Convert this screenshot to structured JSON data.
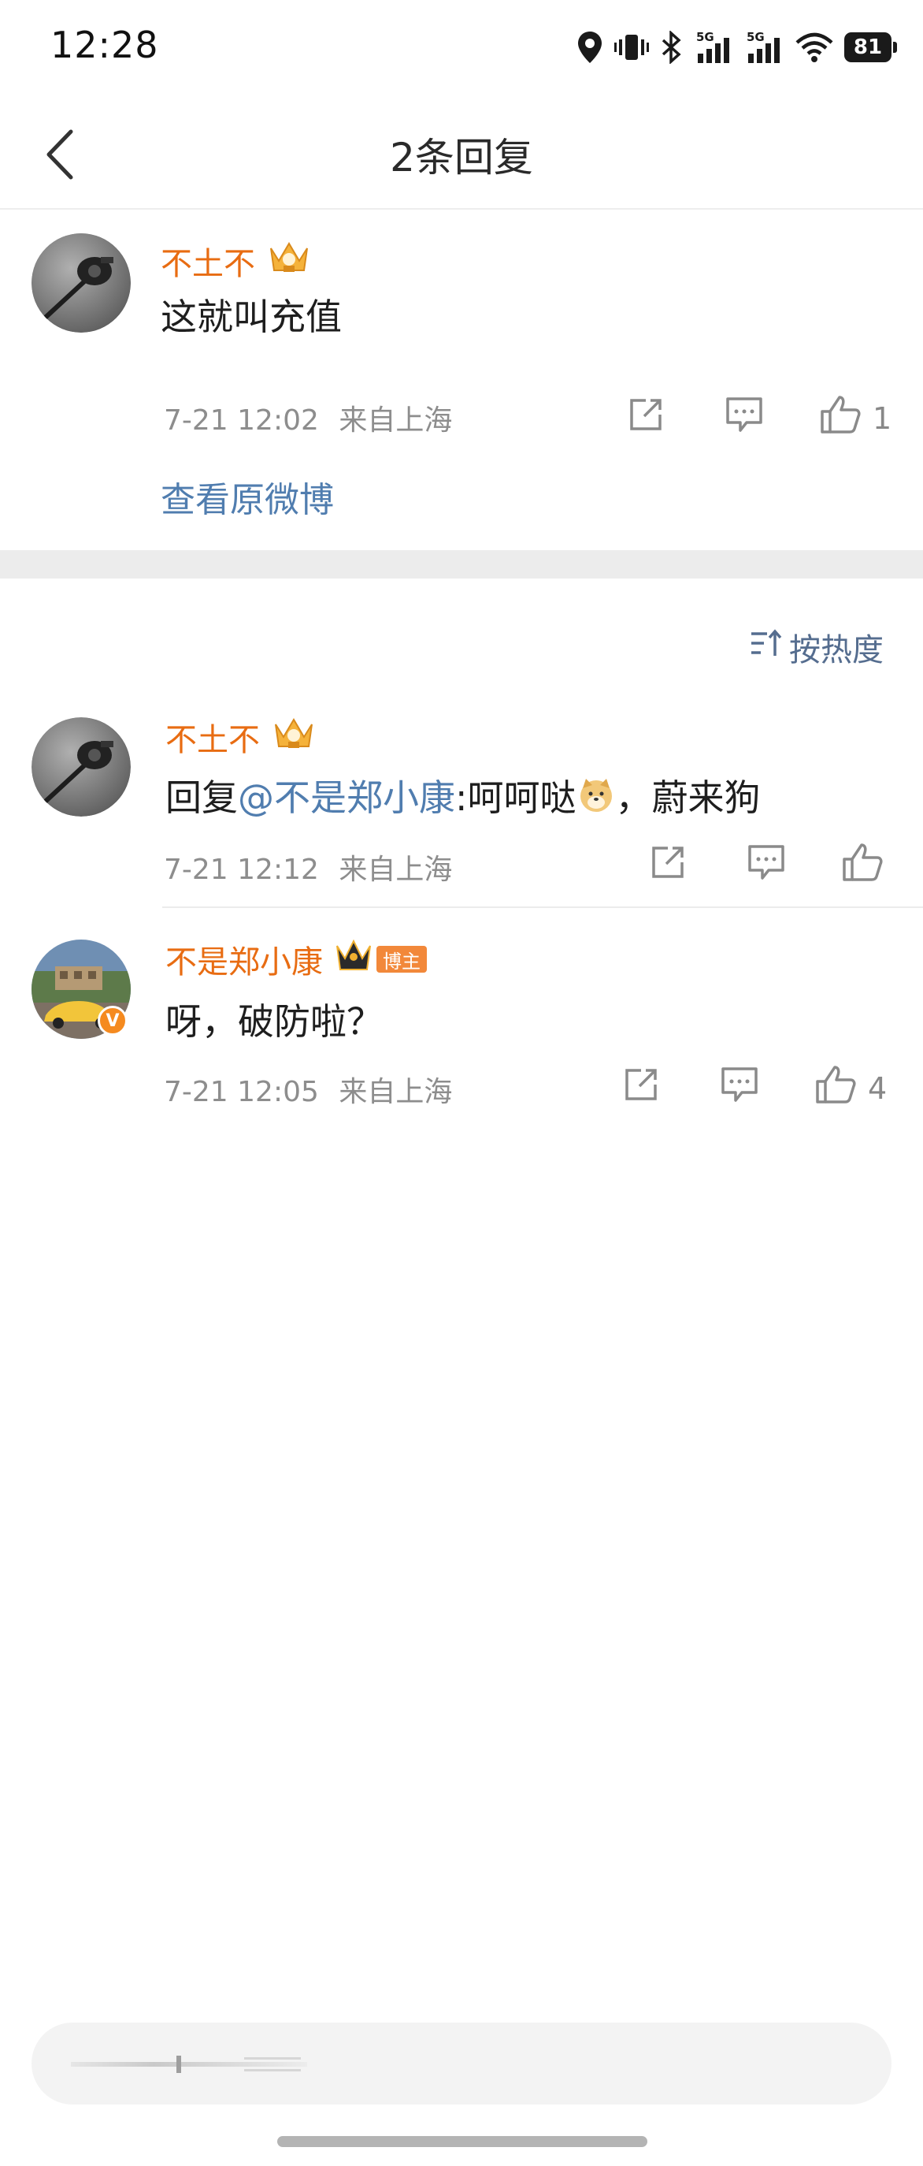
{
  "status_bar": {
    "time": "12:28",
    "battery": "81",
    "network_labels": [
      "5G",
      "5G"
    ],
    "icons": [
      "location-icon",
      "vibrate-icon",
      "bluetooth-icon",
      "signal-icon",
      "signal-icon",
      "wifi-icon",
      "battery-icon"
    ]
  },
  "header": {
    "title": "2条回复",
    "back_icon": "chevron-left-icon"
  },
  "root_comment": {
    "username": "不土不",
    "text": "这就叫充值",
    "time": "7-21 12:02",
    "location": "来自上海",
    "like_count": "1",
    "view_original": "查看原微博"
  },
  "sort": {
    "label": "按热度",
    "icon": "sort-icon"
  },
  "replies": [
    {
      "username": "不土不",
      "reply_prefix": "回复",
      "mention": "@不是郑小康",
      "text_before_emoji": ":呵呵哒",
      "emoji": "doge-emoji",
      "text_after_emoji": "，蔚来狗",
      "time": "7-21 12:12",
      "location": "来自上海",
      "like_count": ""
    },
    {
      "username": "不是郑小康",
      "badge": "博主",
      "verified": "V",
      "text": "呀，破防啦？",
      "time": "7-21 12:05",
      "location": "来自上海",
      "like_count": "4"
    }
  ],
  "input": {
    "placeholder": ""
  },
  "colors": {
    "username": "#e86c12",
    "link": "#507daf",
    "meta": "#8d8d8d",
    "divider_band": "#ececec"
  }
}
